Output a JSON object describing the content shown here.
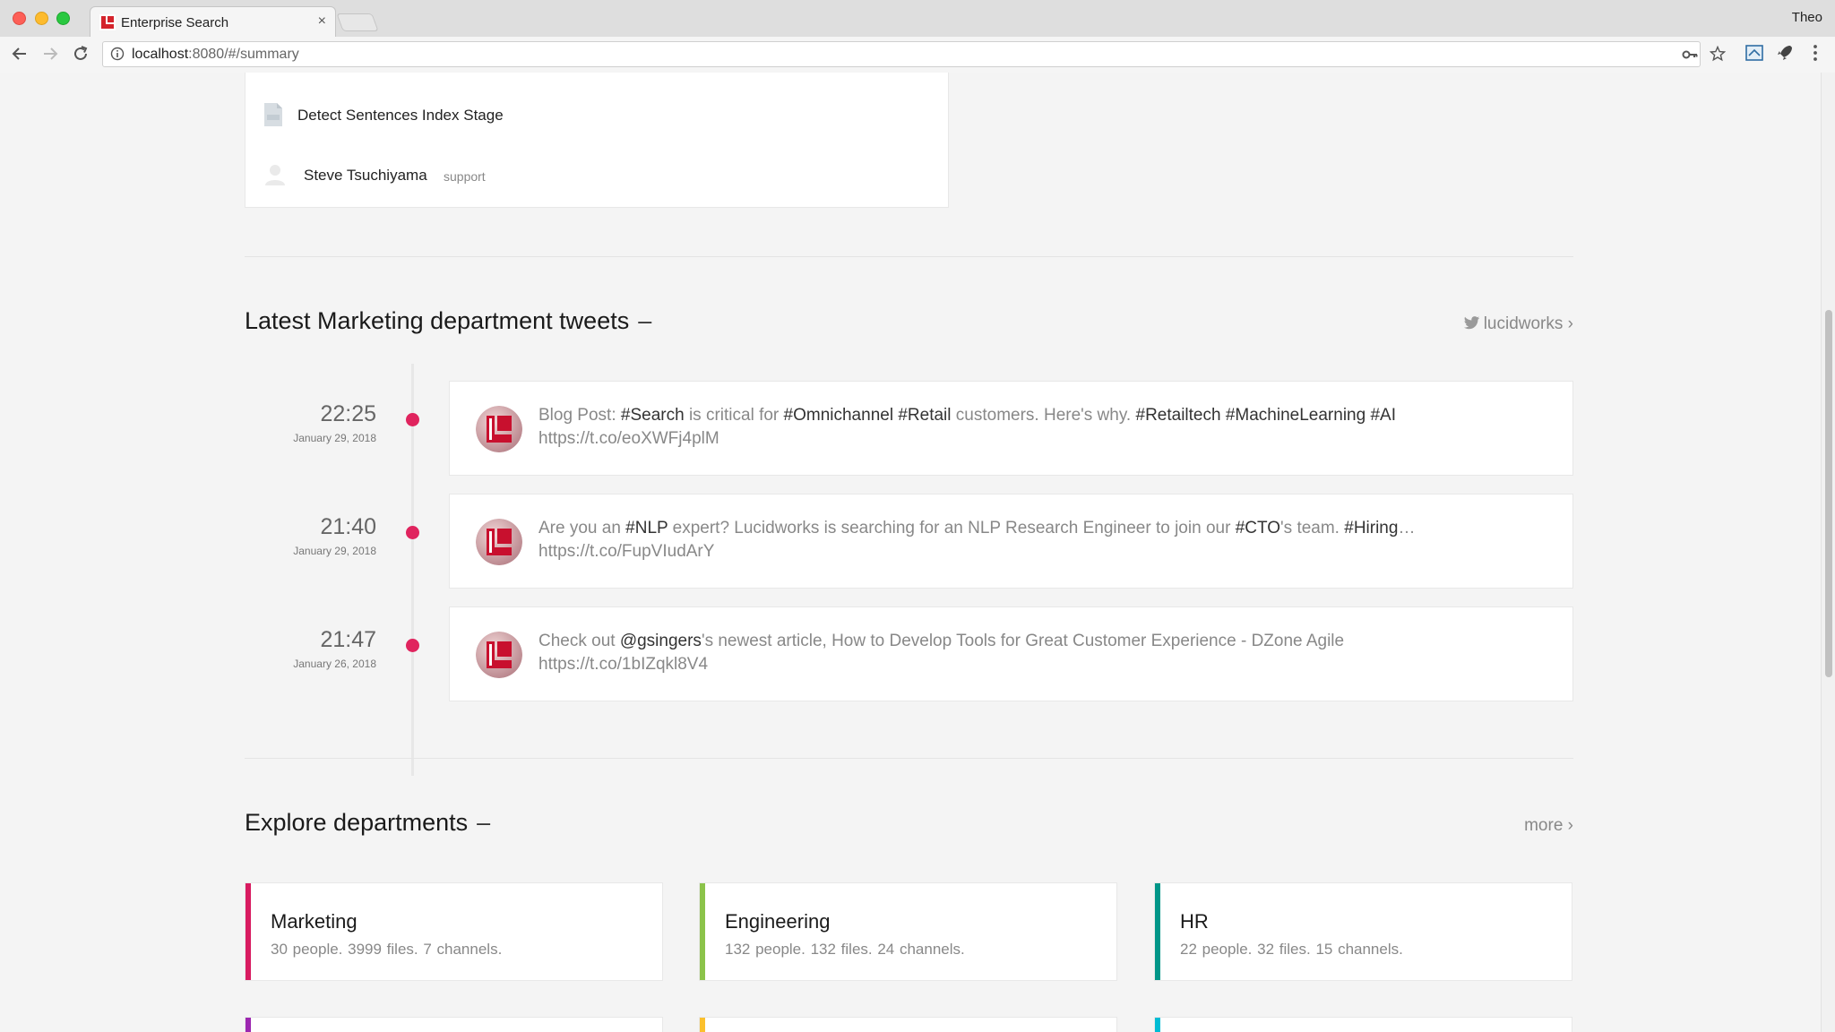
{
  "browser": {
    "tab_title": "Enterprise Search",
    "tab_close": "×",
    "profile_name": "Theo",
    "url_host": "localhost",
    "url_path": ":8080/#/summary"
  },
  "top_card": {
    "document_title": "Detect Sentences Index Stage",
    "person_name": "Steve Tsuchiyama",
    "person_role": "support"
  },
  "tweets_section": {
    "title": "Latest Marketing department tweets",
    "collapse_symbol": "–",
    "link_label": "lucidworks ›",
    "tweets": [
      {
        "time": "22:25",
        "date": "January 29, 2018",
        "segments": [
          {
            "t": "Blog Post: ",
            "hl": false
          },
          {
            "t": "#Search",
            "hl": true
          },
          {
            "t": " is critical for ",
            "hl": false
          },
          {
            "t": "#Omnichannel",
            "hl": true
          },
          {
            "t": " ",
            "hl": false
          },
          {
            "t": "#Retail",
            "hl": true
          },
          {
            "t": " customers. Here's why. ",
            "hl": false
          },
          {
            "t": "#Retailtech",
            "hl": true
          },
          {
            "t": " ",
            "hl": false
          },
          {
            "t": "#MachineLearning",
            "hl": true
          },
          {
            "t": " ",
            "hl": false
          },
          {
            "t": "#AI",
            "hl": true
          }
        ],
        "link": "https://t.co/eoXWFj4plM"
      },
      {
        "time": "21:40",
        "date": "January 29, 2018",
        "segments": [
          {
            "t": "Are you an ",
            "hl": false
          },
          {
            "t": "#NLP",
            "hl": true
          },
          {
            "t": " expert? Lucidworks is searching for an NLP Research Engineer to join our ",
            "hl": false
          },
          {
            "t": "#CTO",
            "hl": true
          },
          {
            "t": "'s team. ",
            "hl": false
          },
          {
            "t": "#Hiring",
            "hl": true
          },
          {
            "t": "…",
            "hl": false
          }
        ],
        "link": "https://t.co/FupVIudArY"
      },
      {
        "time": "21:47",
        "date": "January 26, 2018",
        "segments": [
          {
            "t": "Check out ",
            "hl": false
          },
          {
            "t": "@gsingers",
            "hl": true
          },
          {
            "t": "'s newest article, How to Develop Tools for Great Customer Experience - DZone Agile",
            "hl": false
          }
        ],
        "link": "https://t.co/1bIZqkl8V4"
      }
    ]
  },
  "departments_section": {
    "title": "Explore departments",
    "collapse_symbol": "–",
    "link_label": "more ›",
    "departments": [
      {
        "name": "Marketing",
        "stats": "30 people.  3999 files.  7 channels.",
        "color": "#d81b60"
      },
      {
        "name": "Engineering",
        "stats": "132 people.  132 files.  24 channels.",
        "color": "#8bc34a"
      },
      {
        "name": "HR",
        "stats": "22 people.  32 files.  15 channels.",
        "color": "#009688"
      }
    ],
    "more_row_colors": [
      "#9c27b0",
      "#fbc02d",
      "#00bcd4"
    ]
  }
}
